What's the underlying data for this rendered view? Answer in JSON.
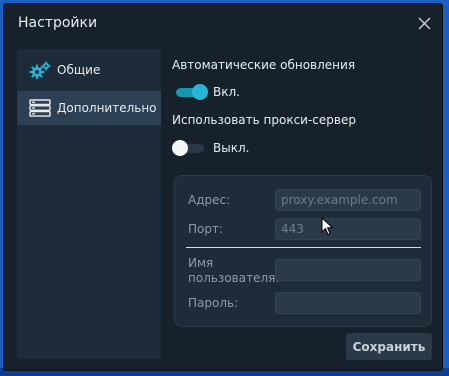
{
  "window": {
    "title": "Настройки"
  },
  "sidebar": {
    "items": [
      {
        "label": "Общие",
        "icon": "gears-icon",
        "active": false
      },
      {
        "label": "Дополнительно",
        "icon": "server-icon",
        "active": true
      }
    ]
  },
  "settings": {
    "auto_update": {
      "label": "Автоматические обновления",
      "enabled": true,
      "state_label": "Вкл."
    },
    "proxy": {
      "label": "Использовать прокси-сервер",
      "enabled": false,
      "state_label": "Выкл."
    }
  },
  "proxy_form": {
    "address": {
      "label": "Адрес:",
      "placeholder": "proxy.example.com",
      "value": ""
    },
    "port": {
      "label": "Порт:",
      "placeholder": "443",
      "value": ""
    },
    "username": {
      "label": "Имя пользователя:",
      "value": ""
    },
    "password": {
      "label": "Пароль:",
      "value": ""
    }
  },
  "buttons": {
    "save": "Сохранить"
  },
  "colors": {
    "accent": "#26b5d4",
    "background": "#17212b",
    "panel": "#1e2c39",
    "desktop": "#1c5fc4"
  }
}
